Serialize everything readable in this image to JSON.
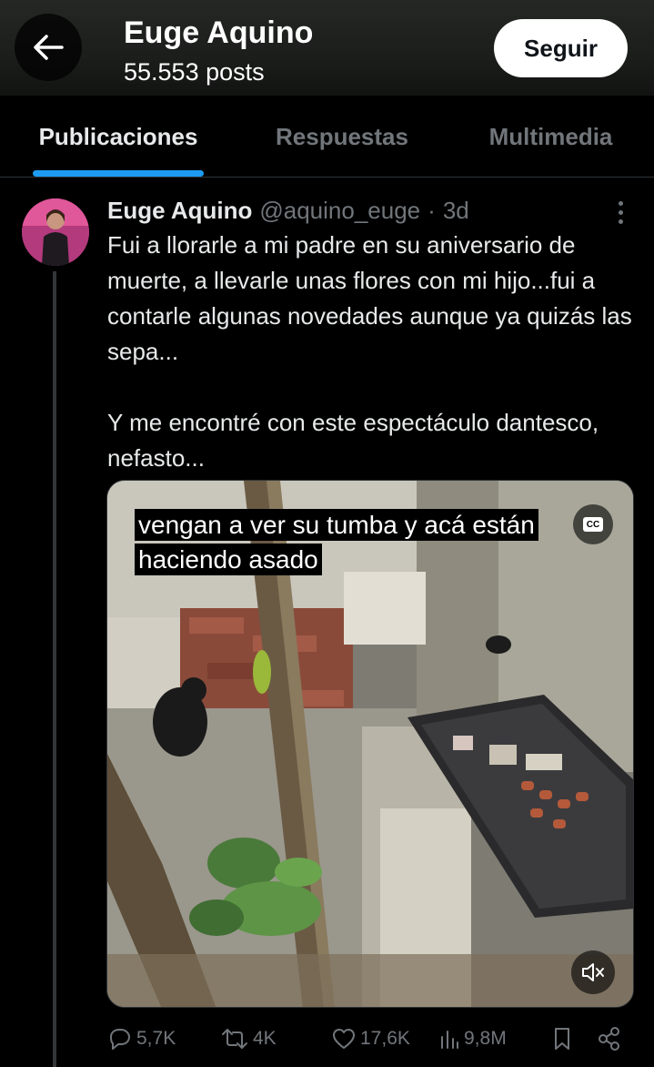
{
  "header": {
    "back_icon": "arrow-left-icon",
    "title": "Euge Aquino",
    "subtitle": "55.553 posts",
    "follow_label": "Seguir"
  },
  "tabs": [
    {
      "label": "Publicaciones",
      "active": true
    },
    {
      "label": "Respuestas",
      "active": false
    },
    {
      "label": "Multimedia",
      "active": false
    }
  ],
  "tweet": {
    "author": "Euge Aquino",
    "handle": "@aquino_euge",
    "separator": "·",
    "time": "3d",
    "paragraphs": [
      "Fui a llorarle a mi padre en su aniversario de muerte, a llevarle unas flores con mi hijo...fui a contarle algunas novedades aunque ya quizás las sepa...",
      "Y me encontré con este espectáculo dantesco, nefasto..."
    ],
    "media": {
      "caption_line1": "vengan a ver su tumba y acá están",
      "caption_line2": "haciendo asado",
      "cc_label": "CC"
    },
    "stats": {
      "replies": "5,7K",
      "reposts": "4K",
      "likes": "17,6K",
      "views": "9,8M"
    }
  },
  "colors": {
    "accent": "#1d9bf0",
    "background": "#000000",
    "muted": "#71767b"
  }
}
